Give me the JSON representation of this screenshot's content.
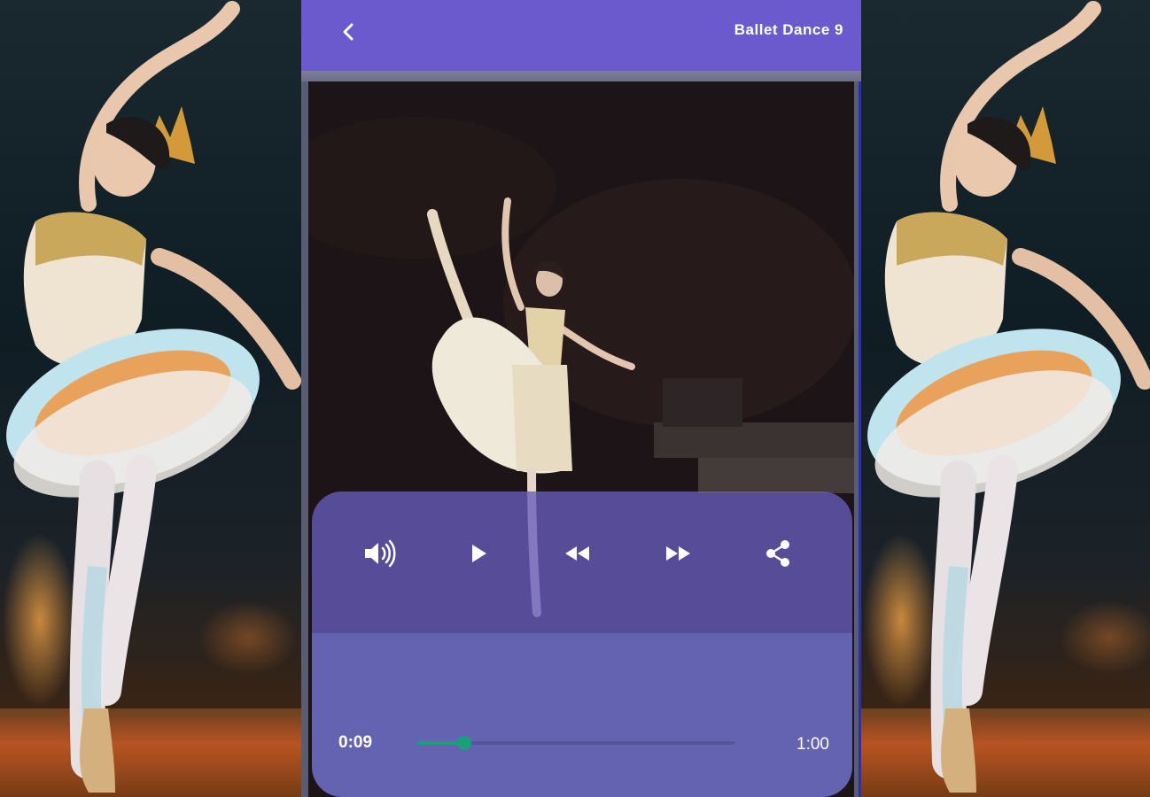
{
  "header": {
    "title": "Ballet Dance 9",
    "back_icon": "chevron-left-icon",
    "bar_color": "#6a5acd"
  },
  "player": {
    "controls": [
      {
        "name": "volume",
        "icon": "volume-icon"
      },
      {
        "name": "play",
        "icon": "play-icon"
      },
      {
        "name": "rewind",
        "icon": "rewind-icon"
      },
      {
        "name": "fast-forward",
        "icon": "fast-forward-icon"
      },
      {
        "name": "share",
        "icon": "share-icon"
      }
    ],
    "current_time": "0:09",
    "duration": "1:00",
    "progress": 0.15,
    "accent_color": "#17a079",
    "panel_color": "#6463b2"
  }
}
